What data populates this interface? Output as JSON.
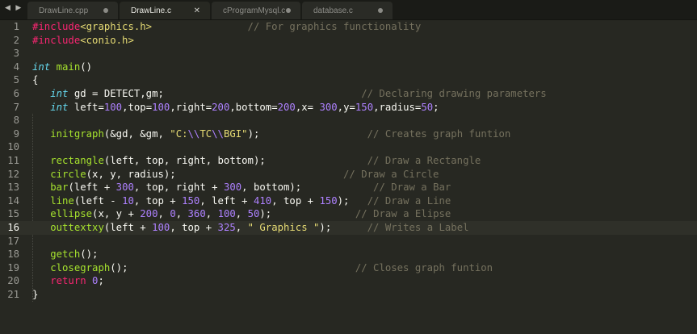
{
  "nav": {
    "arrows": "◀ ▶"
  },
  "tabs": [
    {
      "label": "DrawLine.cpp",
      "state": "modified-dot"
    },
    {
      "label": "DrawLine.c",
      "state": "active-close"
    },
    {
      "label": "cProgramMysql.c",
      "state": "modified-dot"
    },
    {
      "label": "database.c",
      "state": "modified-dot"
    }
  ],
  "editor": {
    "current_line": 16,
    "lines": [
      {
        "n": "1",
        "parts": [
          [
            "kw",
            "#include"
          ],
          [
            "str",
            "<graphics.h>"
          ],
          [
            "",
            "                "
          ],
          [
            "cm",
            "// For graphics functionality"
          ]
        ]
      },
      {
        "n": "2",
        "parts": [
          [
            "kw",
            "#include"
          ],
          [
            "str",
            "<conio.h>"
          ]
        ]
      },
      {
        "n": "3",
        "parts": []
      },
      {
        "n": "4",
        "parts": [
          [
            "type",
            "int"
          ],
          [
            "",
            " "
          ],
          [
            "fn",
            "main"
          ],
          [
            "",
            "()"
          ]
        ]
      },
      {
        "n": "5",
        "parts": [
          [
            "",
            "{"
          ]
        ]
      },
      {
        "n": "6",
        "parts": [
          [
            "",
            "   "
          ],
          [
            "type",
            "int"
          ],
          [
            "",
            " gd = DETECT,gm;                                 "
          ],
          [
            "cm",
            "// Declaring drawing parameters"
          ]
        ]
      },
      {
        "n": "7",
        "parts": [
          [
            "",
            "   "
          ],
          [
            "type",
            "int"
          ],
          [
            "",
            " left="
          ],
          [
            "num",
            "100"
          ],
          [
            "",
            ",top="
          ],
          [
            "num",
            "100"
          ],
          [
            "",
            ",right="
          ],
          [
            "num",
            "200"
          ],
          [
            "",
            ",bottom="
          ],
          [
            "num",
            "200"
          ],
          [
            "",
            ",x= "
          ],
          [
            "num",
            "300"
          ],
          [
            "",
            ",y="
          ],
          [
            "num",
            "150"
          ],
          [
            "",
            ",radius="
          ],
          [
            "num",
            "50"
          ],
          [
            "",
            ";"
          ]
        ]
      },
      {
        "n": "8",
        "parts": []
      },
      {
        "n": "9",
        "parts": [
          [
            "",
            "   "
          ],
          [
            "fn",
            "initgraph"
          ],
          [
            "",
            "(&gd, &gm, "
          ],
          [
            "str",
            "\"C:"
          ],
          [
            "esc",
            "\\\\"
          ],
          [
            "str",
            "TC"
          ],
          [
            "esc",
            "\\\\"
          ],
          [
            "str",
            "BGI\""
          ],
          [
            "",
            ");                  "
          ],
          [
            "cm",
            "// Creates graph funtion"
          ]
        ]
      },
      {
        "n": "10",
        "parts": []
      },
      {
        "n": "11",
        "parts": [
          [
            "",
            "   "
          ],
          [
            "fn",
            "rectangle"
          ],
          [
            "",
            "(left, top, right, bottom);                 "
          ],
          [
            "cm",
            "// Draw a Rectangle"
          ]
        ]
      },
      {
        "n": "12",
        "parts": [
          [
            "",
            "   "
          ],
          [
            "fn",
            "circle"
          ],
          [
            "",
            "(x, y, radius);                            "
          ],
          [
            "cm",
            "// Draw a Circle"
          ]
        ]
      },
      {
        "n": "13",
        "parts": [
          [
            "",
            "   "
          ],
          [
            "fn",
            "bar"
          ],
          [
            "",
            "(left + "
          ],
          [
            "num",
            "300"
          ],
          [
            "",
            ", top, right + "
          ],
          [
            "num",
            "300"
          ],
          [
            "",
            ", bottom);            "
          ],
          [
            "cm",
            "// Draw a Bar"
          ]
        ]
      },
      {
        "n": "14",
        "parts": [
          [
            "",
            "   "
          ],
          [
            "fn",
            "line"
          ],
          [
            "",
            "(left - "
          ],
          [
            "num",
            "10"
          ],
          [
            "",
            ", top + "
          ],
          [
            "num",
            "150"
          ],
          [
            "",
            ", left + "
          ],
          [
            "num",
            "410"
          ],
          [
            "",
            ", top + "
          ],
          [
            "num",
            "150"
          ],
          [
            "",
            ");   "
          ],
          [
            "cm",
            "// Draw a Line"
          ]
        ]
      },
      {
        "n": "15",
        "parts": [
          [
            "",
            "   "
          ],
          [
            "fn",
            "ellipse"
          ],
          [
            "",
            "(x, y + "
          ],
          [
            "num",
            "200"
          ],
          [
            "",
            ", "
          ],
          [
            "num",
            "0"
          ],
          [
            "",
            ", "
          ],
          [
            "num",
            "360"
          ],
          [
            "",
            ", "
          ],
          [
            "num",
            "100"
          ],
          [
            "",
            ", "
          ],
          [
            "num",
            "50"
          ],
          [
            "",
            ");              "
          ],
          [
            "cm",
            "// Draw a Elipse"
          ]
        ]
      },
      {
        "n": "16",
        "parts": [
          [
            "",
            "   "
          ],
          [
            "fn",
            "outtextxy"
          ],
          [
            "",
            "(left + "
          ],
          [
            "num",
            "100"
          ],
          [
            "",
            ", top + "
          ],
          [
            "num",
            "325"
          ],
          [
            "",
            ", "
          ],
          [
            "str",
            "\" Graphics \""
          ],
          [
            "",
            ");      "
          ],
          [
            "cm",
            "// Writes a Label"
          ]
        ]
      },
      {
        "n": "17",
        "parts": []
      },
      {
        "n": "18",
        "parts": [
          [
            "",
            "   "
          ],
          [
            "fn",
            "getch"
          ],
          [
            "",
            "();"
          ]
        ]
      },
      {
        "n": "19",
        "parts": [
          [
            "",
            "   "
          ],
          [
            "fn",
            "closegraph"
          ],
          [
            "",
            "();                                      "
          ],
          [
            "cm",
            "// Closes graph funtion"
          ]
        ]
      },
      {
        "n": "20",
        "parts": [
          [
            "",
            "   "
          ],
          [
            "kw",
            "return"
          ],
          [
            "",
            " "
          ],
          [
            "num",
            "0"
          ],
          [
            "",
            ";"
          ]
        ]
      },
      {
        "n": "21",
        "parts": [
          [
            "",
            "}"
          ]
        ]
      }
    ]
  },
  "colors": {
    "background": "#272822",
    "keyword": "#f92672",
    "type": "#66d9ef",
    "function": "#a6e22e",
    "number": "#ae81ff",
    "string": "#e6db74",
    "comment": "#75715e"
  }
}
